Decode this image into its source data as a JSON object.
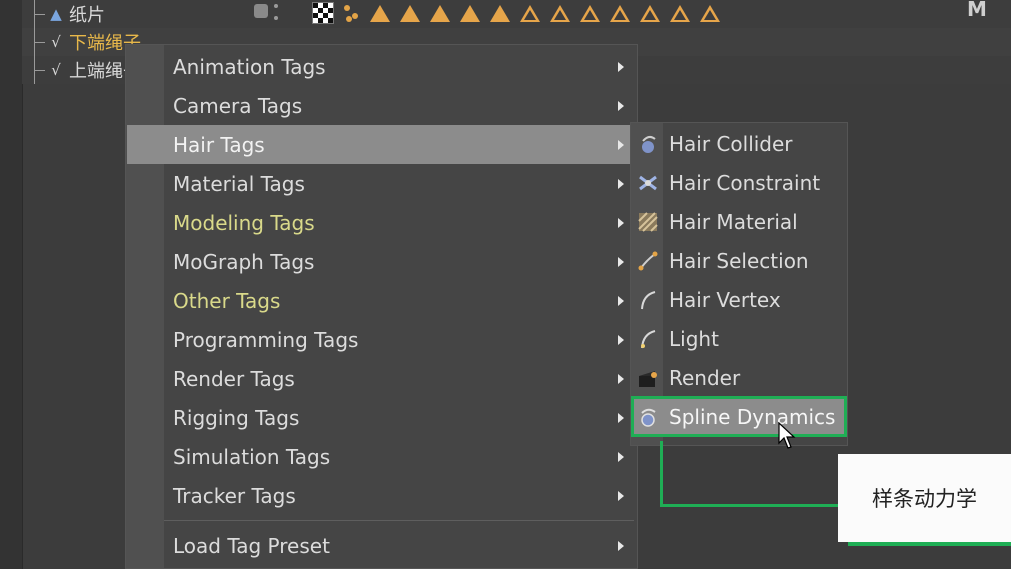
{
  "object_manager": {
    "rows": [
      {
        "name": "纸片",
        "icon": "triangle-icon",
        "color": "#d8d8d8"
      },
      {
        "name": "下端绳子",
        "icon": "spline-icon",
        "color": "#e8b84a"
      },
      {
        "name": "上端绳子",
        "icon": "spline-icon",
        "color": "#d8d8d8"
      }
    ],
    "tag_colors": {
      "triangle": "#e6a54a"
    }
  },
  "context_menu": {
    "items": [
      {
        "label": "Animation Tags",
        "highlight": false,
        "active": false
      },
      {
        "label": "Camera Tags",
        "highlight": false,
        "active": false
      },
      {
        "label": "Hair Tags",
        "highlight": false,
        "active": true
      },
      {
        "label": "Material Tags",
        "highlight": false,
        "active": false
      },
      {
        "label": "Modeling Tags",
        "highlight": true,
        "active": false
      },
      {
        "label": "MoGraph Tags",
        "highlight": false,
        "active": false
      },
      {
        "label": "Other Tags",
        "highlight": true,
        "active": false
      },
      {
        "label": "Programming Tags",
        "highlight": false,
        "active": false
      },
      {
        "label": "Render Tags",
        "highlight": false,
        "active": false
      },
      {
        "label": "Rigging Tags",
        "highlight": false,
        "active": false
      },
      {
        "label": "Simulation Tags",
        "highlight": false,
        "active": false
      },
      {
        "label": "Tracker Tags",
        "highlight": false,
        "active": false
      }
    ],
    "load_preset_label": "Load Tag Preset"
  },
  "hair_submenu": {
    "items": [
      {
        "label": "Hair Collider",
        "icon": "hair-collider-icon"
      },
      {
        "label": "Hair Constraint",
        "icon": "hair-constraint-icon"
      },
      {
        "label": "Hair Material",
        "icon": "hair-material-icon"
      },
      {
        "label": "Hair Selection",
        "icon": "hair-selection-icon"
      },
      {
        "label": "Hair Vertex",
        "icon": "hair-vertex-icon"
      },
      {
        "label": "Light",
        "icon": "hair-light-icon"
      },
      {
        "label": "Render",
        "icon": "hair-render-icon"
      },
      {
        "label": "Spline Dynamics",
        "icon": "spline-dynamics-icon"
      }
    ],
    "hovered": "Spline Dynamics"
  },
  "annotation": {
    "text": "样条动力学",
    "color": "#1fae55"
  },
  "colors": {
    "menu_bg": "#454545",
    "active_bg": "#8c8c8c",
    "highlight_text": "#d9d98a"
  }
}
